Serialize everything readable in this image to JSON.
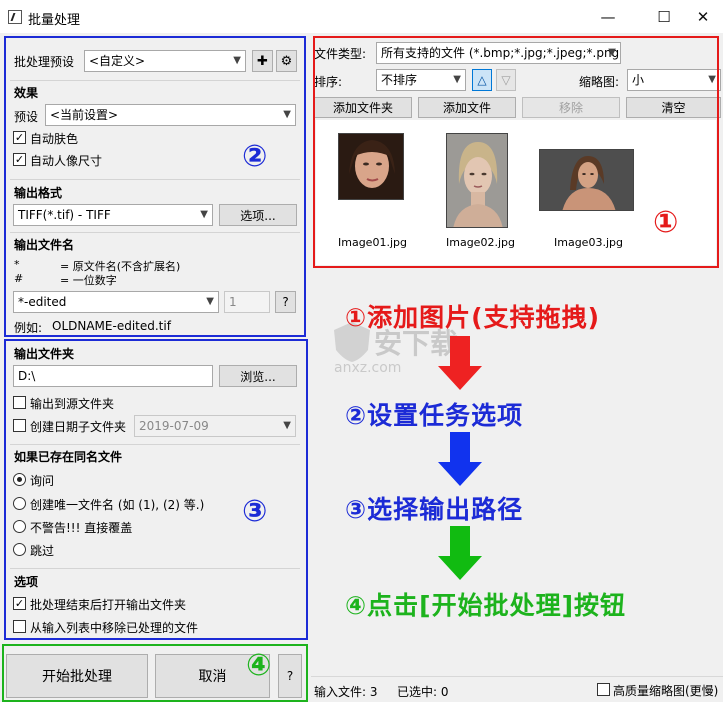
{
  "window": {
    "title": "批量处理",
    "minimize": "—",
    "maximize": "☐",
    "close": "✕"
  },
  "preset_bar": {
    "label": "批处理预设",
    "value": "<自定义>",
    "add_symbol": "✚",
    "settings_symbol": "⚙"
  },
  "effects": {
    "title": "效果",
    "preset_label": "预设",
    "preset_value": "<当前设置>",
    "checkboxes": [
      {
        "label": "自动肤色",
        "checked": true
      },
      {
        "label": "自动人像尺寸",
        "checked": true
      }
    ]
  },
  "output_format": {
    "title": "输出格式",
    "value": "TIFF(*.tif) - TIFF",
    "options_button": "选项..."
  },
  "output_filename": {
    "title": "输出文件名",
    "legend": [
      {
        "symbol": "*",
        "desc": "= 原文件名(不含扩展名)"
      },
      {
        "symbol": "#",
        "desc": "= 一位数字"
      }
    ],
    "pattern": "*-edited",
    "digit": "1",
    "help": "?",
    "example_label": "例如:",
    "example_value": "OLDNAME-edited.tif"
  },
  "output_folder": {
    "title": "输出文件夹",
    "path": "D:\\",
    "browse_button": "浏览...",
    "to_source_label": "输出到源文件夹",
    "to_source_checked": false,
    "date_folder_label": "创建日期子文件夹",
    "date_folder_checked": false,
    "date_value": "2019-07-09"
  },
  "if_exists": {
    "title": "如果已存在同名文件",
    "options": [
      {
        "label": "询问",
        "selected": true
      },
      {
        "label": "创建唯一文件名 (如 (1), (2) 等.)",
        "selected": false
      },
      {
        "label": "不警告!!! 直接覆盖",
        "selected": false
      },
      {
        "label": "跳过",
        "selected": false
      }
    ]
  },
  "extra_options": {
    "title": "选项",
    "checkboxes": [
      {
        "label": "批处理结束后打开输出文件夹",
        "checked": true
      },
      {
        "label": "从输入列表中移除已处理的文件",
        "checked": false
      }
    ]
  },
  "bottom_buttons": {
    "start": "开始批处理",
    "cancel": "取消",
    "help": "?"
  },
  "file_panel": {
    "type_label": "文件类型:",
    "type_value": "所有支持的文件 (*.bmp;*.jpg;*.jpeg;*.png",
    "sort_label": "排序:",
    "sort_value": "不排序",
    "asc_symbol": "△",
    "desc_symbol": "▽",
    "thumb_label": "缩略图:",
    "thumb_value": "小",
    "add_folder": "添加文件夹",
    "add_file": "添加文件",
    "remove": "移除",
    "clear": "清空",
    "images": [
      "Image01.jpg",
      "Image02.jpg",
      "Image03.jpg"
    ]
  },
  "status_bar": {
    "input_files": "输入文件: 3",
    "selected": "已选中: 0",
    "hq_thumbs_label": "高质量缩略图(更慢)",
    "hq_thumbs_checked": false
  },
  "annotations": {
    "num1": "①",
    "num2": "②",
    "num3": "③",
    "num4": "④",
    "step1": "①添加图片(支持拖拽)",
    "step2": "②设置任务选项",
    "step3": "③选择输出路径",
    "step4": "④点击[开始批处理]按钮",
    "watermark_main": "安下载",
    "watermark_sub": "anxz.com"
  },
  "colors": {
    "red": "#e51a1a",
    "blue": "#1c2bd6",
    "green": "#1db31d",
    "arrow_red": "#ee2222",
    "arrow_blue": "#1133ee",
    "arrow_green": "#11bb11"
  }
}
